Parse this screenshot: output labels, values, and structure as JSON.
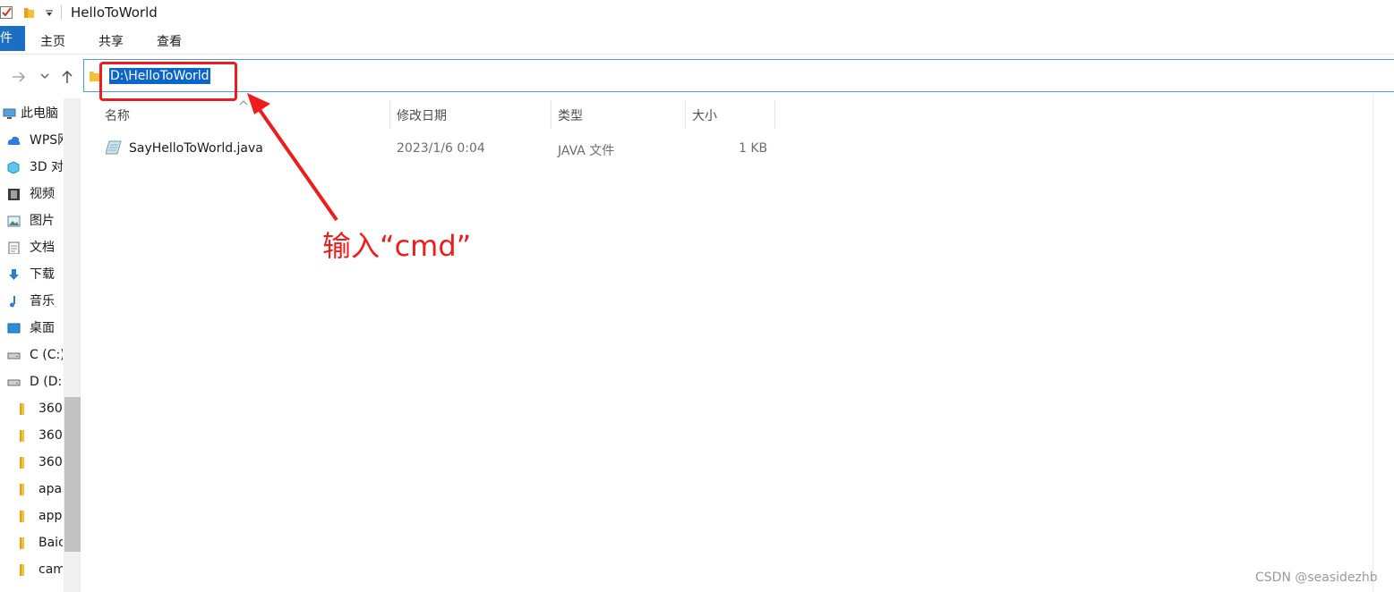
{
  "window": {
    "title": "HelloToWorld"
  },
  "ribbon": {
    "file_tab": "件",
    "tabs": [
      "主页",
      "共享",
      "查看"
    ]
  },
  "address": {
    "path": "D:\\HelloToWorld"
  },
  "nav": {
    "items": [
      {
        "label": "此电脑",
        "icon": "pc-icon"
      },
      {
        "label": "WPS网",
        "icon": "cloud-icon"
      },
      {
        "label": "3D 对",
        "icon": "3d-objects-icon"
      },
      {
        "label": "视频",
        "icon": "video-icon"
      },
      {
        "label": "图片",
        "icon": "picture-icon"
      },
      {
        "label": "文档",
        "icon": "document-icon"
      },
      {
        "label": "下载",
        "icon": "download-icon"
      },
      {
        "label": "音乐",
        "icon": "music-icon"
      },
      {
        "label": "桌面",
        "icon": "desktop-icon"
      },
      {
        "label": "C (C:)",
        "icon": "drive-icon"
      },
      {
        "label": "D (D:)",
        "icon": "drive-icon"
      },
      {
        "label": "360",
        "icon": "folder-icon"
      },
      {
        "label": "360",
        "icon": "folder-icon"
      },
      {
        "label": "360",
        "icon": "folder-icon"
      },
      {
        "label": "apa",
        "icon": "folder-icon"
      },
      {
        "label": "app",
        "icon": "folder-icon"
      },
      {
        "label": "Baic",
        "icon": "folder-icon"
      },
      {
        "label": "cam",
        "icon": "folder-icon"
      }
    ]
  },
  "list": {
    "columns": [
      "名称",
      "修改日期",
      "类型",
      "大小"
    ],
    "rows": [
      {
        "name": "SayHelloToWorld.java",
        "modified": "2023/1/6 0:04",
        "type": "JAVA 文件",
        "size": "1 KB"
      }
    ]
  },
  "annotation": {
    "text": "输入“cmd”"
  },
  "watermark": "CSDN @seasidezhb",
  "colors": {
    "accent": "#1a6fc2",
    "selection": "#0a67c9",
    "annotation": "#ee1c1c"
  }
}
